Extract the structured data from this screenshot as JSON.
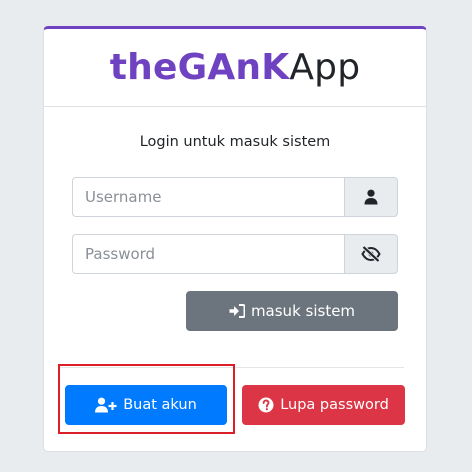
{
  "brand": {
    "bold": "theGAnK",
    "light": "App"
  },
  "login": {
    "message": "Login untuk masuk sistem",
    "username_placeholder": "Username",
    "username_value": "",
    "password_placeholder": "Password",
    "password_value": "",
    "submit_label": "masuk sistem"
  },
  "footer": {
    "register_label": "Buat akun",
    "forgot_label": "Lupa password"
  },
  "icons": {
    "username": "user-icon",
    "password": "eye-slash-icon",
    "submit": "sign-in-icon",
    "register": "user-plus-icon",
    "forgot": "question-circle-icon"
  },
  "colors": {
    "brand": "#6f42c1",
    "primary": "#007bff",
    "danger": "#dc3545",
    "secondary": "#6c757d",
    "highlight": "#dc1f26"
  }
}
